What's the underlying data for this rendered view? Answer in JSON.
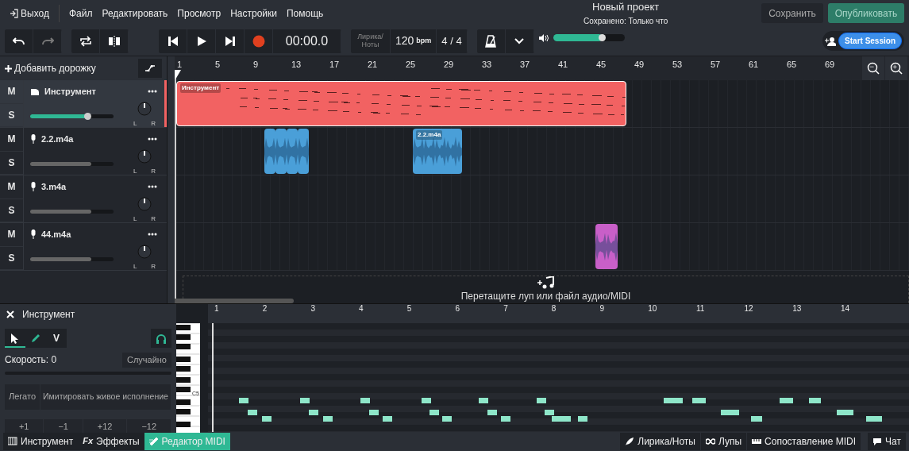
{
  "menu": {
    "exit": "Выход",
    "items": [
      "Файл",
      "Редактировать",
      "Просмотр",
      "Настройки",
      "Помощь"
    ]
  },
  "project": {
    "title": "Новый проект",
    "status": "Сохранено: Только что"
  },
  "actions": [
    {
      "label": "Сохранить",
      "kind": "save"
    },
    {
      "label": "Опубликовать",
      "kind": "publish"
    }
  ],
  "transport": {
    "time": "00:00.0",
    "lyrics": "Лирика/ Ноты",
    "tempo": "120",
    "tempo_unit": "bpm",
    "meter": "4 / 4"
  },
  "master_volume": {
    "level": 0.69
  },
  "session_button": "Start Session",
  "add_track": "Добавить дорожку",
  "ruler": [
    "1",
    "5",
    "9",
    "13",
    "17",
    "21",
    "25",
    "29",
    "33",
    "37",
    "41",
    "45",
    "49",
    "53",
    "57",
    "61",
    "65",
    "69"
  ],
  "tracks": [
    {
      "name": "Инструмент",
      "kind": "instrument",
      "selected": true,
      "level": 0.69,
      "mute": "M",
      "solo": "S",
      "pan_labels": [
        "L",
        "R"
      ],
      "clips": [
        {
          "kind": "midi",
          "label": "Инструмент",
          "color": "#f26262"
        }
      ]
    },
    {
      "name": "2.2.m4a",
      "kind": "audio",
      "selected": false,
      "level": 0.73,
      "mute": "M",
      "solo": "S",
      "pan_labels": [
        "L",
        "R"
      ],
      "clips": [
        {
          "kind": "audio",
          "color": "#4a9fd8"
        },
        {
          "kind": "audio",
          "color": "#4a9fd8"
        },
        {
          "kind": "audio",
          "color": "#4a9fd8"
        },
        {
          "kind": "audio",
          "color": "#4a9fd8"
        },
        {
          "kind": "audio",
          "label": "2.2.m4a",
          "color": "#4a9fd8"
        }
      ]
    },
    {
      "name": "3.m4a",
      "kind": "audio",
      "selected": false,
      "level": 0.73,
      "mute": "M",
      "solo": "S",
      "pan_labels": [
        "L",
        "R"
      ]
    },
    {
      "name": "44.m4a",
      "kind": "audio",
      "selected": false,
      "level": 0.73,
      "mute": "M",
      "solo": "S",
      "pan_labels": [
        "L",
        "R"
      ],
      "clips": [
        {
          "kind": "audio",
          "color": "#c85fc8"
        }
      ]
    }
  ],
  "drop_zone": {
    "text": "Перетащите луп или файл аудио/MIDI"
  },
  "editor": {
    "title": "Инструмент",
    "tools": [
      {
        "kind": "pointer",
        "selected": true
      },
      {
        "kind": "pencil",
        "selected": false
      },
      {
        "kind": "velocity",
        "label": "V",
        "selected": false
      }
    ],
    "monitor_on": true,
    "velocity": "Скорость: 0",
    "random": "Случайно",
    "velocity_bar": {
      "level": 0
    },
    "legato": "Легато",
    "humanize": "Имитировать живое исполнение",
    "transpose": [
      "+1",
      "−1",
      "+12",
      "−12"
    ],
    "key_label": "C5",
    "ruler": [
      "1",
      "2",
      "3",
      "4",
      "5",
      "6",
      "7",
      "8",
      "9",
      "10",
      "11",
      "12",
      "13",
      "14"
    ]
  },
  "bottom_tabs": [
    {
      "label": "Инструмент",
      "kind": "grid",
      "selected": false
    },
    {
      "label": "Эффекты",
      "kind": "fx",
      "icon_text": "Fx",
      "selected": false
    },
    {
      "label": "Редактор MIDI",
      "kind": "midi",
      "selected": true
    }
  ],
  "side_tabs": [
    {
      "label": "Лирика/Ноты",
      "kind": "feather"
    },
    {
      "label": "Лупы",
      "kind": "loop"
    },
    {
      "label": "Сопоставление MIDI",
      "kind": "keys"
    },
    {
      "label": "Чат",
      "kind": "chat"
    }
  ]
}
